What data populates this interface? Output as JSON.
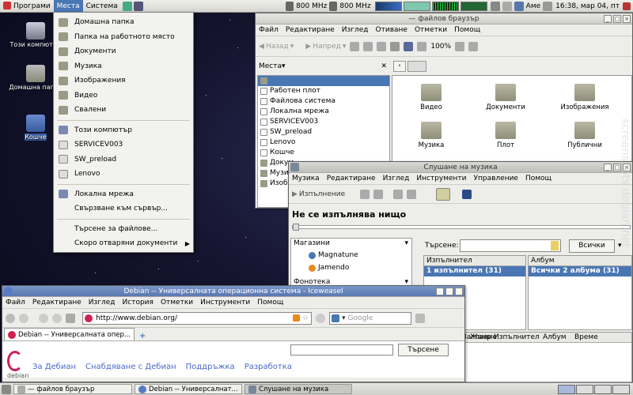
{
  "top_panel": {
    "menus": [
      "Програми",
      "Места",
      "Система"
    ],
    "cpu1": "800 MHz",
    "cpu2": "800 MHz",
    "keyboard": "Аме",
    "clock": "16:38, мар 04, пт"
  },
  "desktop": {
    "icons": [
      "Този компютър",
      "Домашна папка",
      "Кошче"
    ]
  },
  "places_menu": {
    "items": [
      "Домашна папка",
      "Папка на работното място",
      "Документи",
      "Музика",
      "Изображения",
      "Видео",
      "Свалени"
    ],
    "devices": [
      "Този компютър",
      "SERVICEV003",
      "SW_preload",
      "Lenovo"
    ],
    "network": [
      "Локална мрежа",
      "Свързване към сървър..."
    ],
    "other": [
      "Търсене за файлове...",
      "Скоро отваряни документи"
    ]
  },
  "file_browser": {
    "title": "— файлов браузър",
    "menu": [
      "Файл",
      "Редактиране",
      "Изглед",
      "Отиване",
      "Отметки",
      "Помощ"
    ],
    "back": "Назад",
    "forward": "Напред",
    "zoom": "100%",
    "places_label": "Места",
    "sidebar": [
      "",
      "Работен плот",
      "Файлова система",
      "Локална мрежа",
      "SERVICEV003",
      "SW_preload",
      "Lenovo",
      "Кошче",
      "Докум",
      "Музик",
      "Изобр"
    ],
    "folders": [
      "Видео",
      "Документи",
      "Изображения",
      "Музика",
      "Плот",
      "Публични"
    ]
  },
  "music": {
    "title": "Слушане на музика",
    "menu": [
      "Музика",
      "Редактиране",
      "Изглед",
      "Инструменти",
      "Управление",
      "Помощ"
    ],
    "play": "Изпълнение",
    "status": "Не се изпълнява нищо",
    "sources_header": "Магазини",
    "sources": [
      "Magnatune",
      "Jamendo"
    ],
    "library": "Фонотека",
    "search_label": "Търсене:",
    "search_placeholder": "",
    "filter": "Всички",
    "artist_header": "Изпълнител",
    "artist_row": "1 изпълнител (31)",
    "album_header": "Албум",
    "album_row": "Всички 2 албума (31)",
    "track_cols": [
      "Заглавие",
      "Жанр",
      "Изпълнител",
      "Албум",
      "Време"
    ]
  },
  "browser": {
    "title": "Debian -- Универсалната операционна система - Iceweasel",
    "menu": [
      "Файл",
      "Редактиране",
      "Изглед",
      "История",
      "Отметки",
      "Инструменти",
      "Помощ"
    ],
    "url": "http://www.debian.org/",
    "search_engine": "Google",
    "tab": "Debian -- Универсалната опер...",
    "search_button": "Търсене",
    "nav": [
      "За Дебиан",
      "Снабдяване с Дебиан",
      "Поддръжка",
      "Разработка"
    ],
    "logo_text": "debian"
  },
  "taskbar": {
    "tasks": [
      "— файлов браузър",
      "Debian -- Универсалнат...",
      "Слушане на музика"
    ]
  },
  "watermark": "screenshots.debian.net"
}
